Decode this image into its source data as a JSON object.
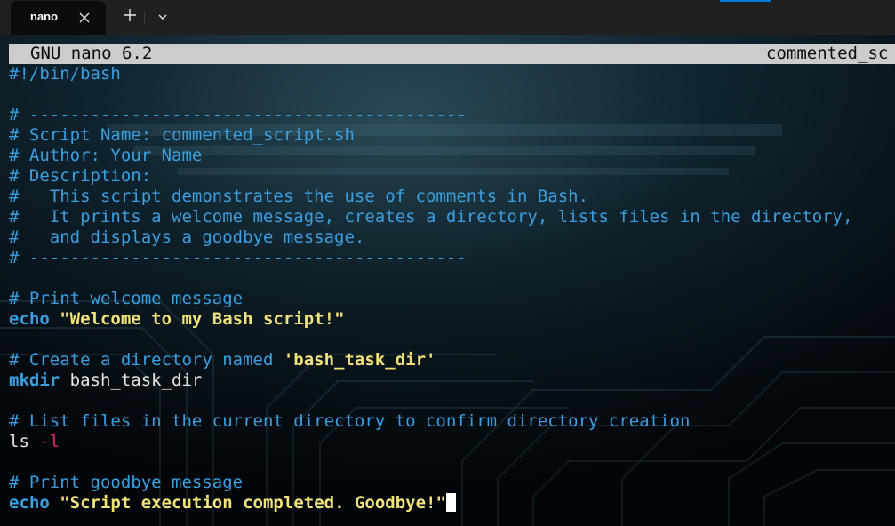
{
  "window": {
    "accent_color": "#0078d4"
  },
  "tabs": [
    {
      "title": "nano",
      "close_icon": "close-icon"
    }
  ],
  "tabbar": {
    "new_tab_icon": "plus-icon",
    "dropdown_icon": "chevron-down-icon"
  },
  "nano": {
    "title": "GNU nano 6.2",
    "filename": "commented_sc"
  },
  "colors": {
    "comment": "#3a9fe0",
    "keyword": "#3a9fe0",
    "string": "#f2e27a",
    "plain": "#e6e6e6",
    "flag": "#e0287a",
    "header_bg": "#cccccc"
  },
  "editor": {
    "lines": [
      {
        "segments": [
          {
            "t": "#!/bin/bash",
            "k": "comment"
          }
        ]
      },
      {
        "segments": []
      },
      {
        "segments": [
          {
            "t": "# -------------------------------------------",
            "k": "comment"
          }
        ]
      },
      {
        "segments": [
          {
            "t": "# Script Name: commented_script.sh",
            "k": "comment"
          }
        ]
      },
      {
        "segments": [
          {
            "t": "# Author: Your Name",
            "k": "comment"
          }
        ]
      },
      {
        "segments": [
          {
            "t": "# Description:",
            "k": "comment"
          }
        ]
      },
      {
        "segments": [
          {
            "t": "#   This script demonstrates the use of comments in Bash.",
            "k": "comment"
          }
        ]
      },
      {
        "segments": [
          {
            "t": "#   It prints a welcome message, creates a directory, lists files in the directory,",
            "k": "comment"
          }
        ]
      },
      {
        "segments": [
          {
            "t": "#   and displays a goodbye message.",
            "k": "comment"
          }
        ]
      },
      {
        "segments": [
          {
            "t": "# -------------------------------------------",
            "k": "comment"
          }
        ]
      },
      {
        "segments": []
      },
      {
        "segments": [
          {
            "t": "# Print welcome message",
            "k": "comment"
          }
        ]
      },
      {
        "segments": [
          {
            "t": "echo",
            "k": "keyword"
          },
          {
            "t": " ",
            "k": "plain"
          },
          {
            "t": "\"Welcome to my Bash script!\"",
            "k": "string"
          }
        ]
      },
      {
        "segments": []
      },
      {
        "segments": [
          {
            "t": "# Create a directory named ",
            "k": "comment"
          },
          {
            "t": "'bash_task_dir'",
            "k": "string"
          }
        ]
      },
      {
        "segments": [
          {
            "t": "mkdir",
            "k": "keyword"
          },
          {
            "t": " bash_task_dir",
            "k": "plain"
          }
        ]
      },
      {
        "segments": []
      },
      {
        "segments": [
          {
            "t": "# List files in the current directory to confirm directory creation",
            "k": "comment"
          }
        ]
      },
      {
        "segments": [
          {
            "t": "ls",
            "k": "plain"
          },
          {
            "t": " ",
            "k": "plain"
          },
          {
            "t": "-l",
            "k": "flag"
          }
        ]
      },
      {
        "segments": []
      },
      {
        "segments": [
          {
            "t": "# Print goodbye message",
            "k": "comment"
          }
        ]
      },
      {
        "segments": [
          {
            "t": "echo",
            "k": "keyword"
          },
          {
            "t": " ",
            "k": "plain"
          },
          {
            "t": "\"Script execution completed. Goodbye!\"",
            "k": "string"
          }
        ],
        "cursor": true
      }
    ]
  }
}
